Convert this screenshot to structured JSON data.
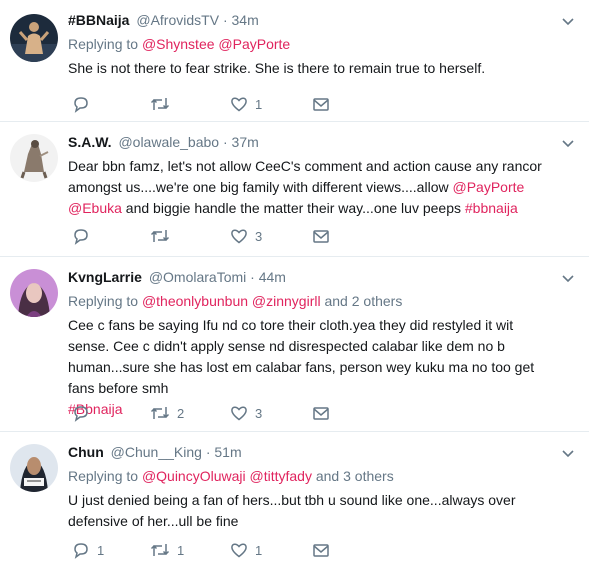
{
  "colors": {
    "accent": "#e0245e",
    "muted": "#657786",
    "icon": "#657786"
  },
  "tweets": [
    {
      "name": "#BBNaija",
      "handle": "@AfrovidsTV",
      "dot": "·",
      "time": "34m",
      "replying_prefix": "Replying to ",
      "replying_to": [
        "@Shynstee",
        "@PayPorte"
      ],
      "replying_others": "",
      "text": "She is not there to fear strike. She is there to remain true to herself.",
      "counts": {
        "reply": "",
        "retweet": "",
        "like": "1"
      }
    },
    {
      "name": "S.A.W.",
      "handle": "@olawale_babo",
      "dot": "·",
      "time": "37m",
      "text_before": "Dear bbn famz, let's not allow CeeC's comment and action cause any rancor amongst us....we're one big family with different views....allow ",
      "mention1": "@PayPorte",
      "mention2": "@Ebuka",
      "text_middle": " and biggie handle the matter their way...one luv peeps ",
      "hashtag": "#bbnaija",
      "counts": {
        "reply": "",
        "retweet": "",
        "like": "3"
      }
    },
    {
      "name": "KvngLarrie",
      "handle": "@OmolaraTomi",
      "dot": "·",
      "time": "44m",
      "replying_prefix": "Replying to ",
      "replying_to": [
        "@theonlybunbun",
        "@zinnygirll"
      ],
      "replying_others": "and 2 others",
      "text": "Cee c fans be saying Ifu nd co tore their cloth.yea they did restyled it wit sense. Cee c didn't apply sense nd disrespected calabar like dem no b human...sure she has lost em calabar fans, person wey kuku ma no too get fans before smh",
      "hashtag": "#Bbnaija",
      "counts": {
        "reply": "",
        "retweet": "2",
        "like": "3"
      }
    },
    {
      "name": "Chun",
      "handle": "@Chun__King",
      "dot": "·",
      "time": "51m",
      "replying_prefix": "Replying to ",
      "replying_to": [
        "@QuincyOluwaji",
        "@tittyfady"
      ],
      "replying_others": "and 3 others",
      "text": "U just denied being a fan of hers...but tbh u sound like one...always over defensive of her...ull be fine",
      "counts": {
        "reply": "1",
        "retweet": "1",
        "like": "1"
      }
    }
  ],
  "icons": {
    "reply": "reply-icon",
    "retweet": "retweet-icon",
    "like": "heart-icon",
    "dm": "envelope-icon",
    "caret": "chevron-down-icon"
  }
}
